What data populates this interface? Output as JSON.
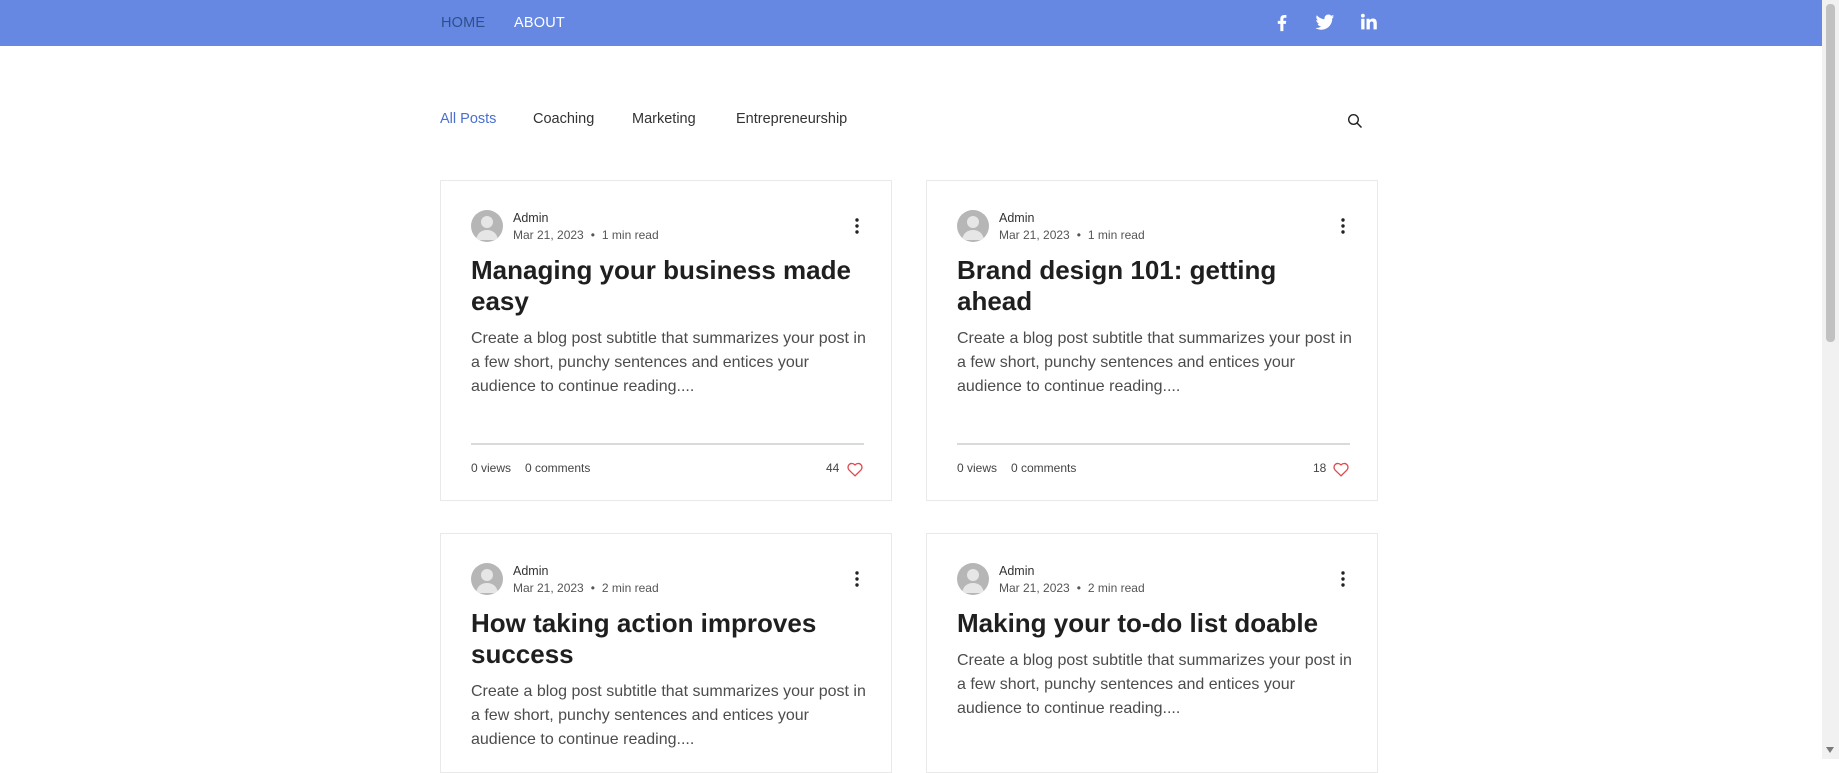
{
  "nav": {
    "home": "HOME",
    "about": "ABOUT",
    "social": [
      "facebook-icon",
      "twitter-icon",
      "linkedin-icon"
    ]
  },
  "categories": [
    "All Posts",
    "Coaching",
    "Marketing",
    "Entrepreneurship"
  ],
  "colors": {
    "header": "#6688e3",
    "accent": "#4a6fd0",
    "heart": "#e0474c"
  },
  "posts": [
    {
      "author": "Admin",
      "date": "Mar 21, 2023",
      "read_time": "1 min read",
      "title": "Managing your business made easy",
      "excerpt": "Create a blog post subtitle that summarizes your post in a few short, punchy sentences and entices your audience to continue reading....",
      "views": "0 views",
      "comments": "0 comments",
      "likes": "44"
    },
    {
      "author": "Admin",
      "date": "Mar 21, 2023",
      "read_time": "1 min read",
      "title": "Brand design 101: getting ahead",
      "excerpt": "Create a blog post subtitle that summarizes your post in a few short, punchy sentences and entices your audience to continue reading....",
      "views": "0 views",
      "comments": "0 comments",
      "likes": "18"
    },
    {
      "author": "Admin",
      "date": "Mar 21, 2023",
      "read_time": "2 min read",
      "title": "How taking action improves success",
      "excerpt": "Create a blog post subtitle that summarizes your post in a few short, punchy sentences and entices your audience to continue reading....",
      "views": "",
      "comments": "",
      "likes": ""
    },
    {
      "author": "Admin",
      "date": "Mar 21, 2023",
      "read_time": "2 min read",
      "title": "Making your to-do list doable",
      "excerpt": "Create a blog post subtitle that summarizes your post in a few short, punchy sentences and entices your audience to continue reading....",
      "views": "",
      "comments": "",
      "likes": ""
    }
  ]
}
